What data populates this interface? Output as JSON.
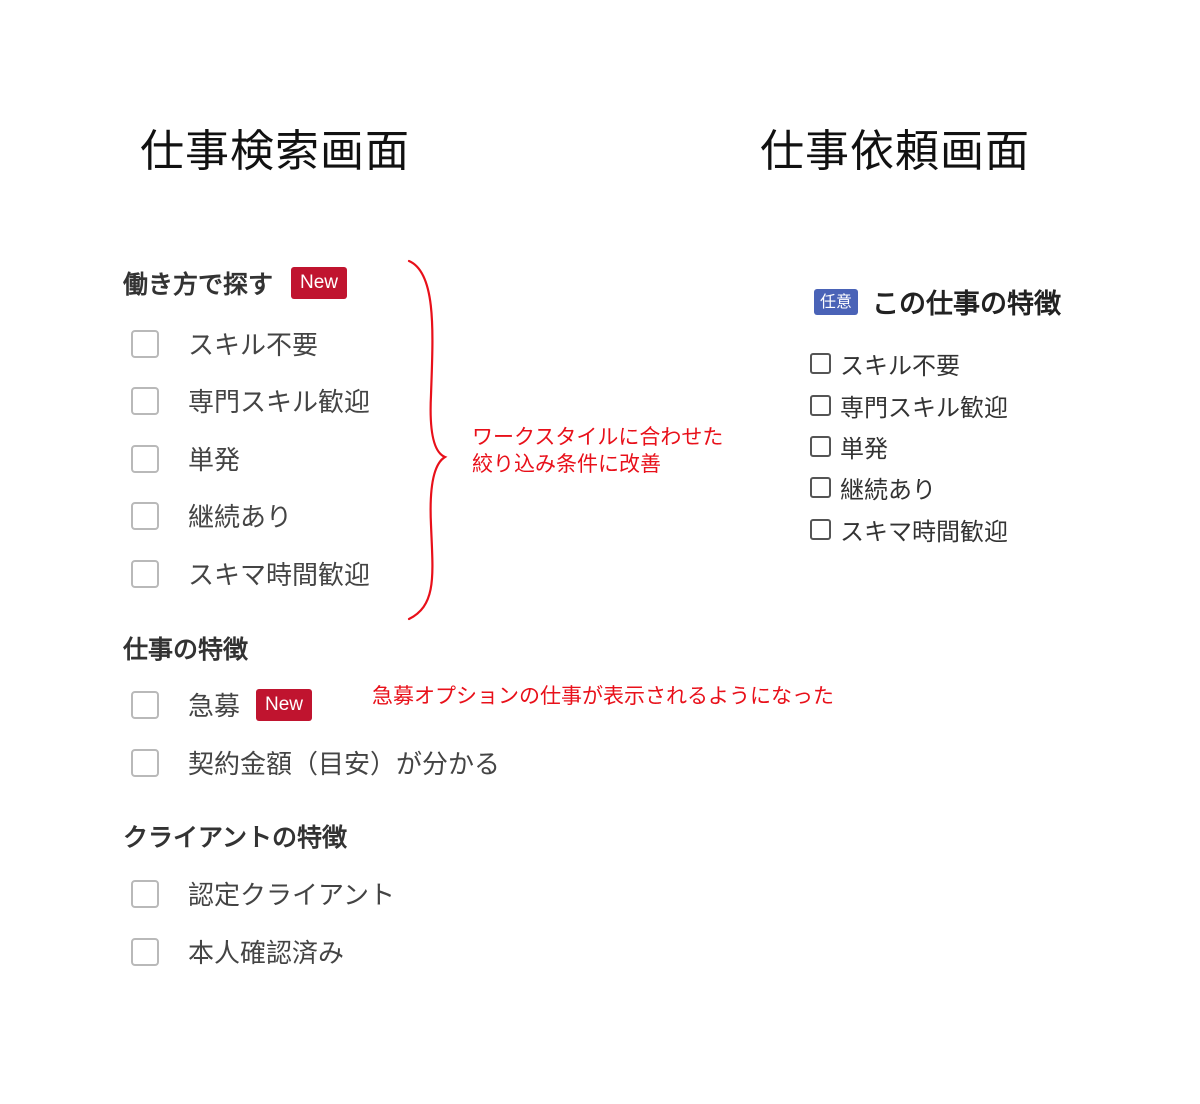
{
  "screens": {
    "search": {
      "title": "仕事検索画面",
      "work_style": {
        "heading": "働き方で探す",
        "badge": "New",
        "options": [
          "スキル不要",
          "専門スキル歓迎",
          "単発",
          "継続あり",
          "スキマ時間歓迎"
        ]
      },
      "job_features": {
        "heading": "仕事の特徴",
        "options": [
          {
            "label": "急募",
            "badge": "New"
          },
          {
            "label": "契約金額（目安）が分かる"
          }
        ]
      },
      "client_features": {
        "heading": "クライアントの特徴",
        "options": [
          "認定クライアント",
          "本人確認済み"
        ]
      }
    },
    "request": {
      "title": "仕事依頼画面",
      "tag": "任意",
      "heading": "この仕事の特徴",
      "options": [
        "スキル不要",
        "専門スキル歓迎",
        "単発",
        "継続あり",
        "スキマ時間歓迎"
      ]
    }
  },
  "annotations": {
    "work_style_note": {
      "line1": "ワークスタイルに合わせた",
      "line2": "絞り込み条件に改善"
    },
    "urgent_note": "急募オプションの仕事が表示されるようになった"
  },
  "colors": {
    "badge_new": "#c0142f",
    "tag_optional": "#4a63b7",
    "annotation": "#e8101a"
  }
}
